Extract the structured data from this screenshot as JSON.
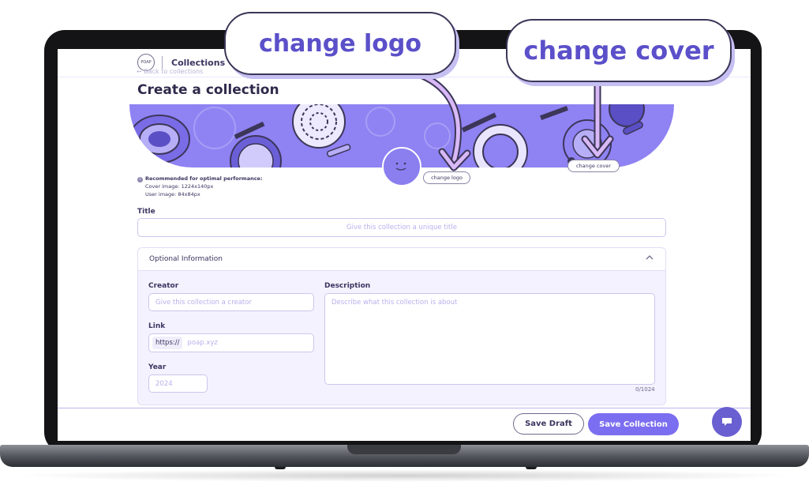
{
  "header": {
    "logo_text": "POAP",
    "title": "Collections",
    "back_link": "← Back to collections"
  },
  "page": {
    "title": "Create a collection"
  },
  "cover": {
    "change_logo_label": "change logo",
    "change_cover_label": "change cover"
  },
  "recommendation": {
    "heading": "Recommended for optimal performance:",
    "cover": "Cover image: 1224x140px",
    "user": "User image: 84x84px"
  },
  "form": {
    "title_label": "Title",
    "title_placeholder": "Give this collection a unique title",
    "optional_label": "Optional Information",
    "creator_label": "Creator",
    "creator_placeholder": "Give this collection a creator",
    "link_label": "Link",
    "link_prefix": "https://",
    "link_placeholder": "poap.xyz",
    "year_label": "Year",
    "year_placeholder": "2024",
    "description_label": "Description",
    "description_placeholder": "Describe what this collection is about",
    "description_counter": "0/1024"
  },
  "footer": {
    "save_draft": "Save Draft",
    "save_collection": "Save Collection"
  },
  "callouts": {
    "logo": "change logo",
    "cover": "change cover"
  },
  "colors": {
    "accent": "#7c6ef0",
    "callout_text": "#5b50c9",
    "annotation_arrow": "#d8b8f6"
  },
  "icons": {
    "info": "info-icon",
    "collapse": "chevron-up-icon",
    "chat": "chat-icon"
  }
}
